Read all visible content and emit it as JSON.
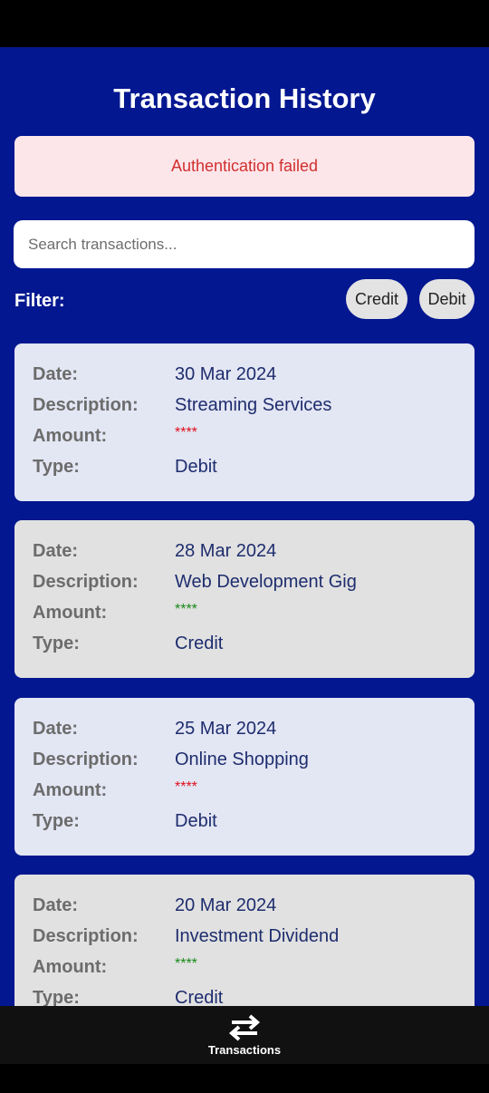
{
  "header": {
    "title": "Transaction History"
  },
  "alert": {
    "message": "Authentication failed"
  },
  "search": {
    "placeholder": "Search transactions..."
  },
  "filter": {
    "label": "Filter:",
    "options": [
      "Credit",
      "Debit"
    ]
  },
  "field_labels": {
    "date": "Date:",
    "description": "Description:",
    "amount": "Amount:",
    "type": "Type:"
  },
  "transactions": [
    {
      "date": "30 Mar 2024",
      "description": "Streaming Services",
      "amount": "****",
      "type": "Debit"
    },
    {
      "date": "28 Mar 2024",
      "description": "Web Development Gig",
      "amount": "****",
      "type": "Credit"
    },
    {
      "date": "25 Mar 2024",
      "description": "Online Shopping",
      "amount": "****",
      "type": "Debit"
    },
    {
      "date": "20 Mar 2024",
      "description": "Investment Dividend",
      "amount": "****",
      "type": "Credit"
    }
  ],
  "bottom_nav": {
    "items": [
      {
        "label": "Transactions",
        "icon": "swap-arrows-icon"
      }
    ]
  },
  "colors": {
    "background": "#021790",
    "alert_bg": "#fde6ea",
    "alert_text": "#d0302f",
    "debit_amount": "#e01020",
    "credit_amount": "#1a8a1a",
    "debit_card": "#e3e6f3",
    "credit_card": "#e1e1e1"
  }
}
